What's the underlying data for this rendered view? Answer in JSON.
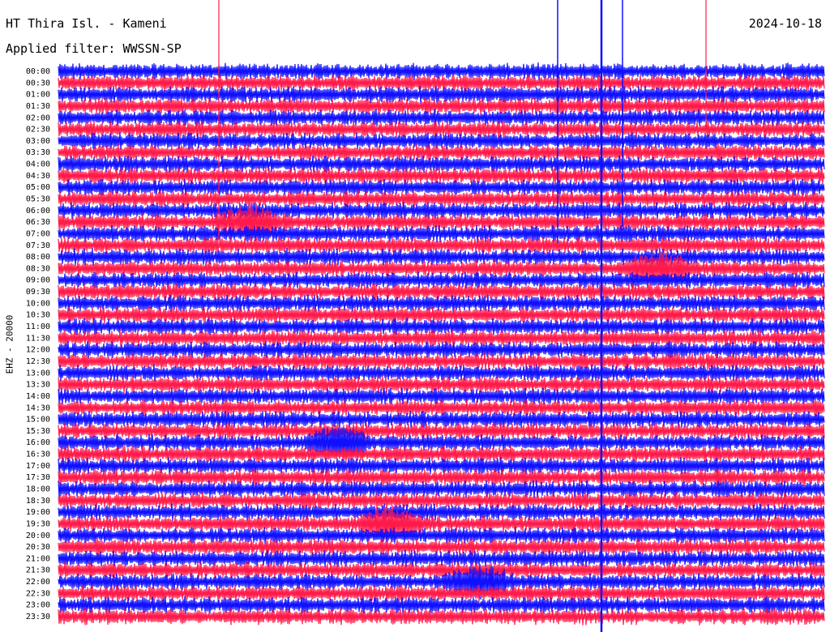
{
  "header": {
    "station": "HT Thira Isl. - Kameni",
    "date": "2024-10-18",
    "filter": "Applied filter: WWSSN-SP"
  },
  "channel_label": "EHZ - 20000",
  "colors": {
    "trace_a": "#1010ff",
    "trace_b": "#ff1a4a",
    "background": "#ffffff",
    "text": "#000000"
  },
  "chart_data": {
    "type": "helicorder",
    "title": "HT Thira Isl. - Kameni",
    "date": "2024-10-18",
    "filter": "WWSSN-SP",
    "channel": "EHZ - 20000",
    "row_interval_minutes": 30,
    "row_labels": [
      "00:00",
      "00:30",
      "01:00",
      "01:30",
      "02:00",
      "02:30",
      "03:00",
      "03:30",
      "04:00",
      "04:30",
      "05:00",
      "05:30",
      "06:00",
      "06:30",
      "07:00",
      "07:30",
      "08:00",
      "08:30",
      "09:00",
      "09:30",
      "10:00",
      "10:30",
      "11:00",
      "11:30",
      "12:00",
      "12:30",
      "13:00",
      "13:30",
      "14:00",
      "14:30",
      "15:00",
      "15:30",
      "16:00",
      "16:30",
      "17:00",
      "17:30",
      "18:00",
      "18:30",
      "19:00",
      "19:30",
      "20:00",
      "20:30",
      "21:00",
      "21:30",
      "22:00",
      "22:30",
      "23:00",
      "23:30"
    ],
    "trace_colors_alternate": [
      "blue",
      "red"
    ],
    "events": [
      {
        "row": "06:30",
        "minute": 7.5,
        "note": "large spike"
      },
      {
        "row": "16:00",
        "minute": 11,
        "note": "emergent signal"
      },
      {
        "row": "19:30",
        "minute": 13,
        "note": "burst"
      },
      {
        "row": "08:30",
        "minute": 23.5,
        "note": "emergent signal"
      },
      {
        "row": "22:00",
        "minute": 16.5,
        "note": "burst"
      }
    ]
  }
}
